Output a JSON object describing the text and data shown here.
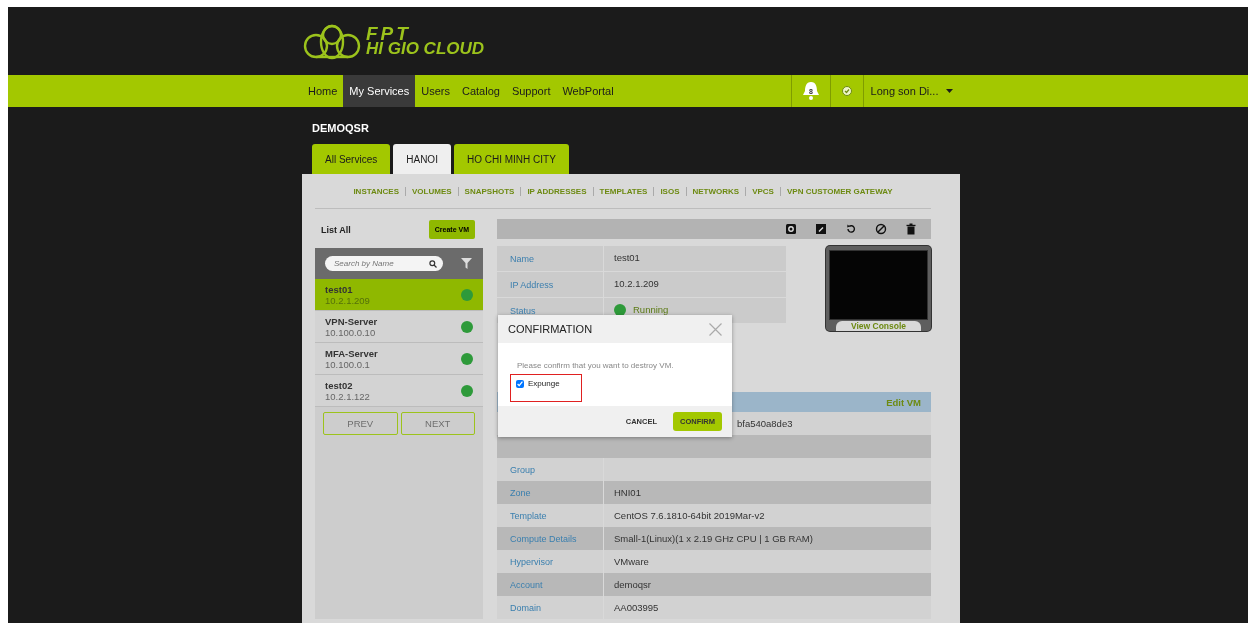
{
  "logo": {
    "line1": "FPT",
    "line2": "HI GIO CLOUD"
  },
  "nav": {
    "items": [
      {
        "label": "Home",
        "selected": false
      },
      {
        "label": "My Services",
        "selected": true
      },
      {
        "label": "Users",
        "selected": false
      },
      {
        "label": "Catalog",
        "selected": false
      },
      {
        "label": "Support",
        "selected": false
      },
      {
        "label": "WebPortal",
        "selected": false
      }
    ],
    "notifications": "8",
    "user": "Long son Di..."
  },
  "customer": "DEMOQSR",
  "region_tabs": [
    {
      "label": "All Services",
      "selected": false
    },
    {
      "label": "HANOI",
      "selected": true
    },
    {
      "label": "HO CHI MINH CITY",
      "selected": false
    }
  ],
  "subnav": [
    "INSTANCES",
    "VOLUMES",
    "SNAPSHOTS",
    "IP ADDRESSES",
    "TEMPLATES",
    "ISOS",
    "NETWORKS",
    "VPCS",
    "VPN CUSTOMER GATEWAY"
  ],
  "vm_list": {
    "title": "List All",
    "create_button": "Create VM",
    "search_placeholder": "Search by Name",
    "items": [
      {
        "name": "test01",
        "ip": "10.2.1.209",
        "selected": true,
        "color": "#2e9a3a"
      },
      {
        "name": "VPN-Server",
        "ip": "10.100.0.10",
        "selected": false,
        "color": "#2e9a3a"
      },
      {
        "name": "MFA-Server",
        "ip": "10.100.0.1",
        "selected": false,
        "color": "#2e9a3a"
      },
      {
        "name": "test02",
        "ip": "10.2.1.122",
        "selected": false,
        "color": "#2e9a3a"
      }
    ],
    "prev": "PREV",
    "next": "NEXT"
  },
  "details": {
    "summary": [
      {
        "kind": "text",
        "label": "Name",
        "value": "test01"
      },
      {
        "kind": "text",
        "label": "IP Address",
        "value": "10.2.1.209"
      },
      {
        "kind": "status",
        "label": "Status",
        "value": "Running",
        "color": "#2e9a3a"
      }
    ],
    "console": "View Console",
    "edit": "Edit VM",
    "rows": [
      {
        "kind": "partly_hidden",
        "value": "bfa540a8de3"
      },
      {
        "kind": "hidden"
      },
      {
        "kind": "text",
        "label": "Group"
      },
      {
        "kind": "text",
        "label": "Zone",
        "value": "HNI01"
      },
      {
        "kind": "text",
        "label": "Template",
        "value": "CentOS 7.6.1810-64bit 2019Mar-v2"
      },
      {
        "kind": "text",
        "label": "Compute Details",
        "value": "Small-1(Linux)(1 x 2.19 GHz CPU | 1 GB RAM)"
      },
      {
        "kind": "text",
        "label": "Hypervisor",
        "value": "VMware"
      },
      {
        "kind": "text",
        "label": "Account",
        "value": "demoqsr"
      },
      {
        "kind": "text",
        "label": "Domain",
        "value": "AA003995"
      }
    ]
  },
  "dialog": {
    "title": "CONFIRMATION",
    "message": "Please confirm that you want to destroy VM.",
    "option": {
      "label": "Expunge",
      "checked": true
    },
    "cancel": "CANCEL",
    "confirm": "CONFIRM"
  }
}
